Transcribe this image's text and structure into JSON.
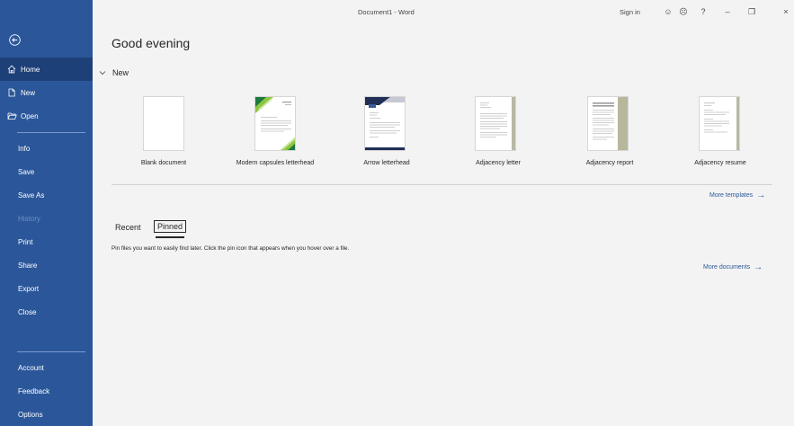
{
  "window": {
    "title": "Document1  -  Word",
    "sign_in": "Sign in",
    "controls": {
      "smiley": "☺",
      "frown": "☹",
      "help": "?",
      "minimize": "–",
      "restore": "❐",
      "close": "×"
    }
  },
  "sidebar": {
    "items": [
      {
        "label": "Home",
        "icon": "home-icon",
        "selected": true
      },
      {
        "label": "New",
        "icon": "new-document-icon"
      },
      {
        "label": "Open",
        "icon": "folder-open-icon"
      },
      {
        "label": "Info"
      },
      {
        "label": "Save"
      },
      {
        "label": "Save As"
      },
      {
        "label": "History",
        "disabled": true
      },
      {
        "label": "Print"
      },
      {
        "label": "Share"
      },
      {
        "label": "Export"
      },
      {
        "label": "Close"
      },
      {
        "label": "Account"
      },
      {
        "label": "Feedback"
      },
      {
        "label": "Options"
      }
    ]
  },
  "main": {
    "greeting": "Good evening",
    "new_section": "New",
    "templates": [
      {
        "label": "Blank document"
      },
      {
        "label": "Modern capsules letterhead"
      },
      {
        "label": "Arrow letterhead"
      },
      {
        "label": "Adjacency letter"
      },
      {
        "label": "Adjacency report"
      },
      {
        "label": "Adjacency resume"
      }
    ],
    "more_templates": "More templates",
    "tabs": {
      "recent": "Recent",
      "pinned": "Pinned"
    },
    "pin_hint": "Pin files you want to easily find later. Click the pin icon that appears when you hover over a file.",
    "more_documents": "More documents",
    "arrow": "→"
  },
  "colors": {
    "sidebar": "#2b579a",
    "sidebar_selected": "#1e4078",
    "link": "#2b579a",
    "background": "#f3f3f3"
  }
}
